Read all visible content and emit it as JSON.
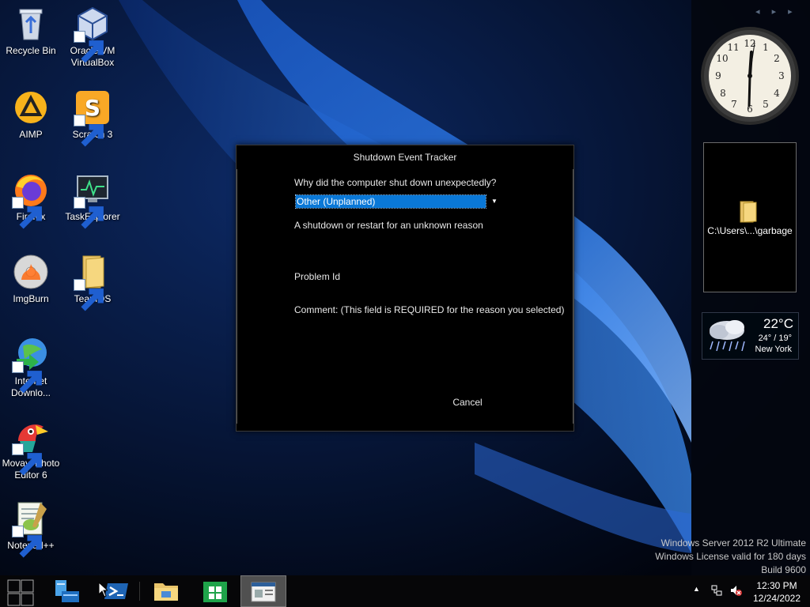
{
  "desktop": {
    "icons": [
      {
        "label": "Recycle Bin",
        "icon": "recycle-bin-icon"
      },
      {
        "label": "Oracle VM VirtualBox",
        "icon": "virtualbox-icon"
      },
      {
        "label": "AIMP",
        "icon": "aimp-icon"
      },
      {
        "label": "Scratch 3",
        "icon": "scratch-icon"
      },
      {
        "label": "Firefox",
        "icon": "firefox-icon"
      },
      {
        "label": "TaskExplorer",
        "icon": "taskexplorer-icon"
      },
      {
        "label": "ImgBurn",
        "icon": "imgburn-icon"
      },
      {
        "label": "TeamOS",
        "icon": "folder-icon"
      },
      {
        "label": "Internet Downlo...",
        "icon": "internet-download-manager-icon"
      },
      {
        "label": "Movavi Photo Editor 6",
        "icon": "movavi-icon"
      },
      {
        "label": "Notepad++",
        "icon": "notepadpp-icon"
      }
    ]
  },
  "gadgets": {
    "nav": "◂ ▸ ▸",
    "slideshow_label": "C:\\Users\\...\\garbage",
    "weather": {
      "temp": "22°C",
      "range": "24° / 19°",
      "city": "New York"
    }
  },
  "dialog": {
    "title": "Shutdown Event Tracker",
    "question": "Why did the computer shut down unexpectedly?",
    "selected_reason": "Other (Unplanned)",
    "reason_description": "A shutdown or restart for an unknown reason",
    "problem_id_label": "Problem Id",
    "comment_label": "Comment: (This field is REQUIRED for the reason you selected)",
    "cancel_label": "Cancel"
  },
  "watermark": {
    "line1": "Windows Server 2012 R2 Ultimate",
    "line2": "Windows License valid for 180 days",
    "line3": "Build 9600"
  },
  "taskbar": {
    "time": "12:30 PM",
    "date": "12/24/2022"
  },
  "colors": {
    "selection_blue": "#0a78d7",
    "dialog_bg": "#000000",
    "taskbar_bg": "#060608"
  }
}
